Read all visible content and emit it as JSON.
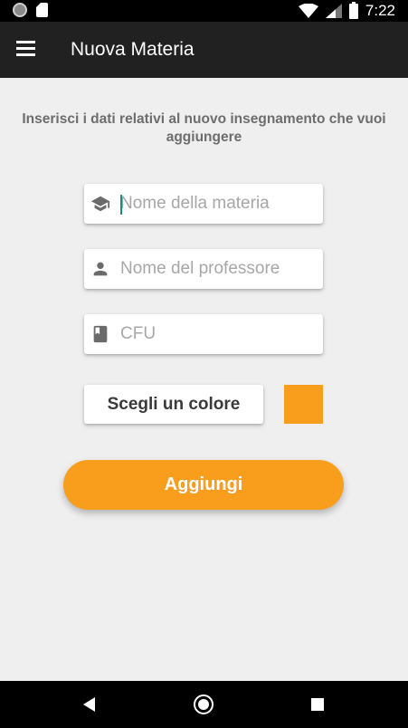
{
  "status_bar": {
    "time": "7:22",
    "icons": [
      "notification-circle-icon",
      "sd-card-icon",
      "wifi-icon",
      "signal-icon",
      "battery-icon"
    ]
  },
  "toolbar": {
    "menu_icon": "hamburger-menu-icon",
    "title": "Nuova Materia"
  },
  "form": {
    "intro_text": "Inserisci i dati relativi al nuovo insegnamento che vuoi aggiungere",
    "subject_name": {
      "icon": "graduation-cap-icon",
      "placeholder": "Nome della materia",
      "value": ""
    },
    "professor_name": {
      "icon": "person-icon",
      "placeholder": "Nome del professore",
      "value": ""
    },
    "cfu": {
      "icon": "book-icon",
      "placeholder": "CFU",
      "value": ""
    },
    "choose_color_label": "Scegli un colore",
    "selected_color": "#f99d1c",
    "add_label": "Aggiungi"
  },
  "colors": {
    "accent": "#f99d1c",
    "toolbar": "#212121",
    "background": "#efefef"
  },
  "nav_bar": {
    "icons": [
      "back-icon",
      "home-icon",
      "recents-icon"
    ]
  }
}
